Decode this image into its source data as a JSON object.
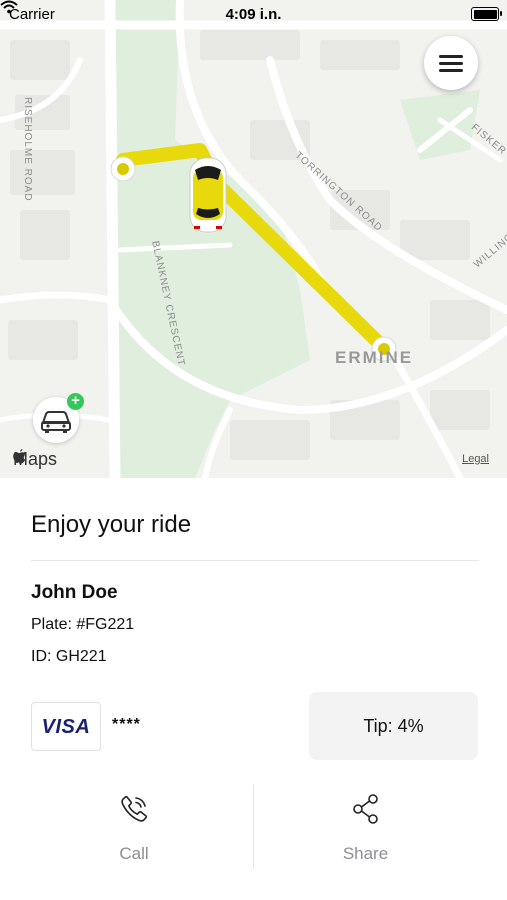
{
  "status_bar": {
    "carrier": "Carrier",
    "time": "4:09 i.n."
  },
  "map": {
    "streets": {
      "risholme": "RISEHOLME ROAD",
      "torrington": "TORRINGTON ROAD",
      "blankney": "BLANKNEY CRESCENT",
      "fisker": "FISKER",
      "willing": "WILLING"
    },
    "area_label": "ERMINE",
    "maps_brand": "Maps",
    "legal": "Legal",
    "route_color": "#e8d90c"
  },
  "ride": {
    "title": "Enjoy your ride",
    "driver_name": "John Doe",
    "plate": "Plate: #FG221",
    "driver_id": "ID: GH221"
  },
  "payment": {
    "card_brand": "VISA",
    "card_mask": "****",
    "tip": "Tip: 4%"
  },
  "actions": {
    "call": "Call",
    "share": "Share"
  },
  "icons": [
    "wifi-icon",
    "battery-icon",
    "menu-icon",
    "car-icon",
    "plus-icon",
    "apple-icon",
    "phone-icon",
    "share-icon"
  ]
}
